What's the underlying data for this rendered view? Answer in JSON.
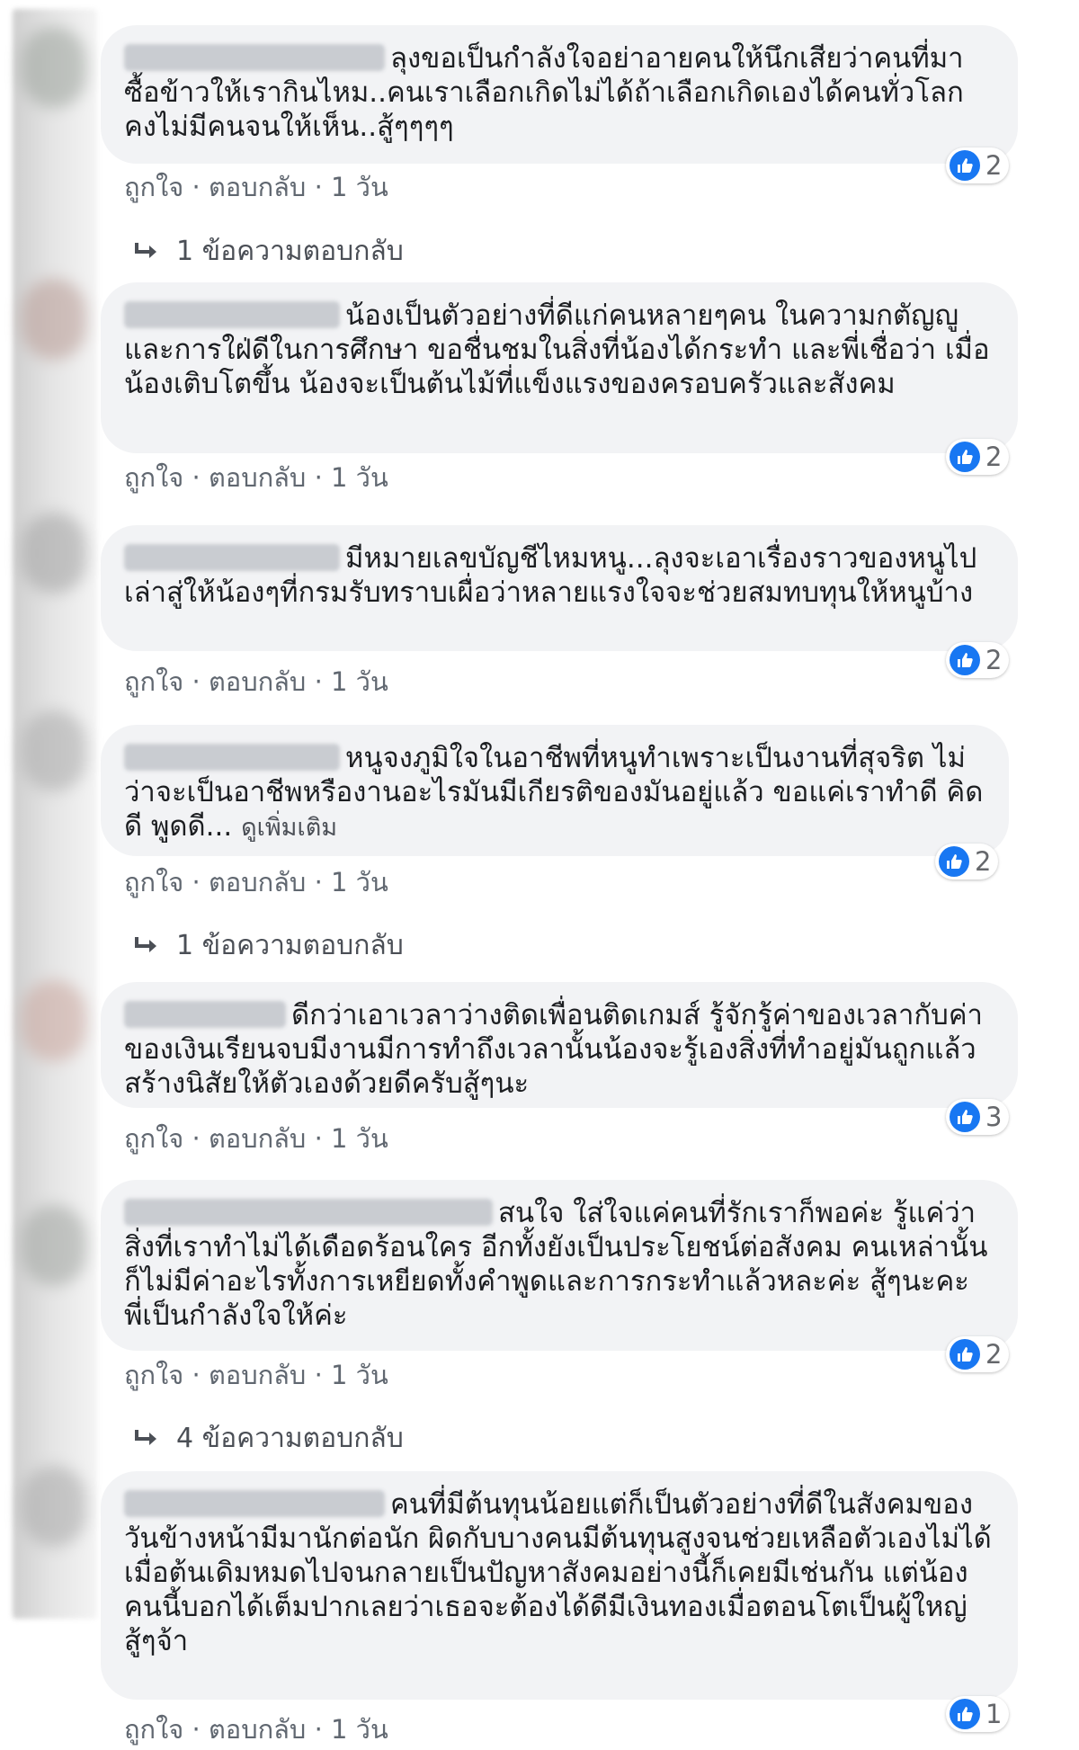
{
  "actions": {
    "like": "ถูกใจ",
    "dot": "·",
    "reply": "ตอบกลับ",
    "time": "1 วัน"
  },
  "colors": {
    "like_blue": "#1877f2",
    "bubble": "#f2f3f5"
  },
  "comments": [
    {
      "text": "ลุงขอเป็นกำลังใจอย่าอายคนให้นึกเสียว่าคนที่มาซื้อข้าวให้เรากินไหม..คนเราเลือกเกิดไม่ได้ถ้าเลือกเกิดเองได้คนทั่วโลกคงไม่มีคนจนให้เห็น..สู้ๆๆๆๆ",
      "reactions": "2",
      "replies": "1 ข้อความตอบกลับ"
    },
    {
      "text": "น้องเป็นตัวอย่างที่ดีแก่คนหลายๆคน ในความกตัญญู และการใฝ่ดีในการศึกษา ขอชื่นชมในสิ่งที่น้องได้กระทำ และพี่เชื่อว่า เมื่อน้องเติบโตขึ้น น้องจะเป็นต้นไม้ที่แข็งแรงของครอบครัวและสังคม",
      "reactions": "2"
    },
    {
      "text": "มีหมายเลขบัญชีไหมหนู...ลุงจะเอาเรื่องราวของหนูไปเล่าสู่ให้น้องๆที่กรมรับทราบเผื่อว่าหลายแรงใจจะช่วยสมทบทุนให้หนูบ้าง",
      "reactions": "2"
    },
    {
      "text": "หนูจงภูมิใจในอาชีพที่หนูทำเพราะเป็นงานที่สุจริต ไม่ว่าจะเป็นอาชีพหรืองานอะไรมันมีเกียรติของมันอยู่แล้ว ขอแค่เราทำดี คิดดี พูดดี...",
      "see_more": "ดูเพิ่มเติม",
      "reactions": "2",
      "replies": "1 ข้อความตอบกลับ"
    },
    {
      "text": "ดีกว่าเอาเวลาว่างติดเพื่อนติดเกมส์ รู้จักรู้ค่าของเวลากับค่าของเงินเรียนจบมีงานมีการทำถึงเวลานั้นน้องจะรู้เองสิ่งที่ทำอยู่มันถูกแล้ว สร้างนิสัยให้ตัวเองด้วยดีครับสู้ๆนะ",
      "reactions": "3"
    },
    {
      "text": "สนใจ ใส่ใจแค่คนที่รักเราก็พอค่ะ รู้แค่ว่าสิ่งที่เราทำไม่ได้เดือดร้อนใคร อีกทั้งยังเป็นประโยชน์ต่อสังคม คนเหล่านั้นก็ไม่มีค่าอะไรทั้งการเหยียดทั้งคำพูดและการกระทำแล้วหละค่ะ สู้ๆนะคะ พี่เป็นกำลังใจให้ค่ะ",
      "reactions": "2",
      "replies": "4 ข้อความตอบกลับ"
    },
    {
      "text": "คนที่มีต้นทุนน้อยแต่ก็เป็นตัวอย่างที่ดีในสังคมของวันข้างหน้ามีมานักต่อนัก ผิดกับบางคนมีต้นทุนสูงจนช่วยเหลือตัวเองไม่ได้เมื่อต้นเดิมหมดไปจนกลายเป็นปัญหาสังคมอย่างนี้ก็เคยมีเช่นกัน แต่น้องคนนี้บอกได้เต็มปากเลยว่าเธอจะต้องได้ดีมีเงินทองเมื่อตอนโตเป็นผู้ใหญ่ สู้ๆจ้า",
      "reactions": "1"
    }
  ]
}
